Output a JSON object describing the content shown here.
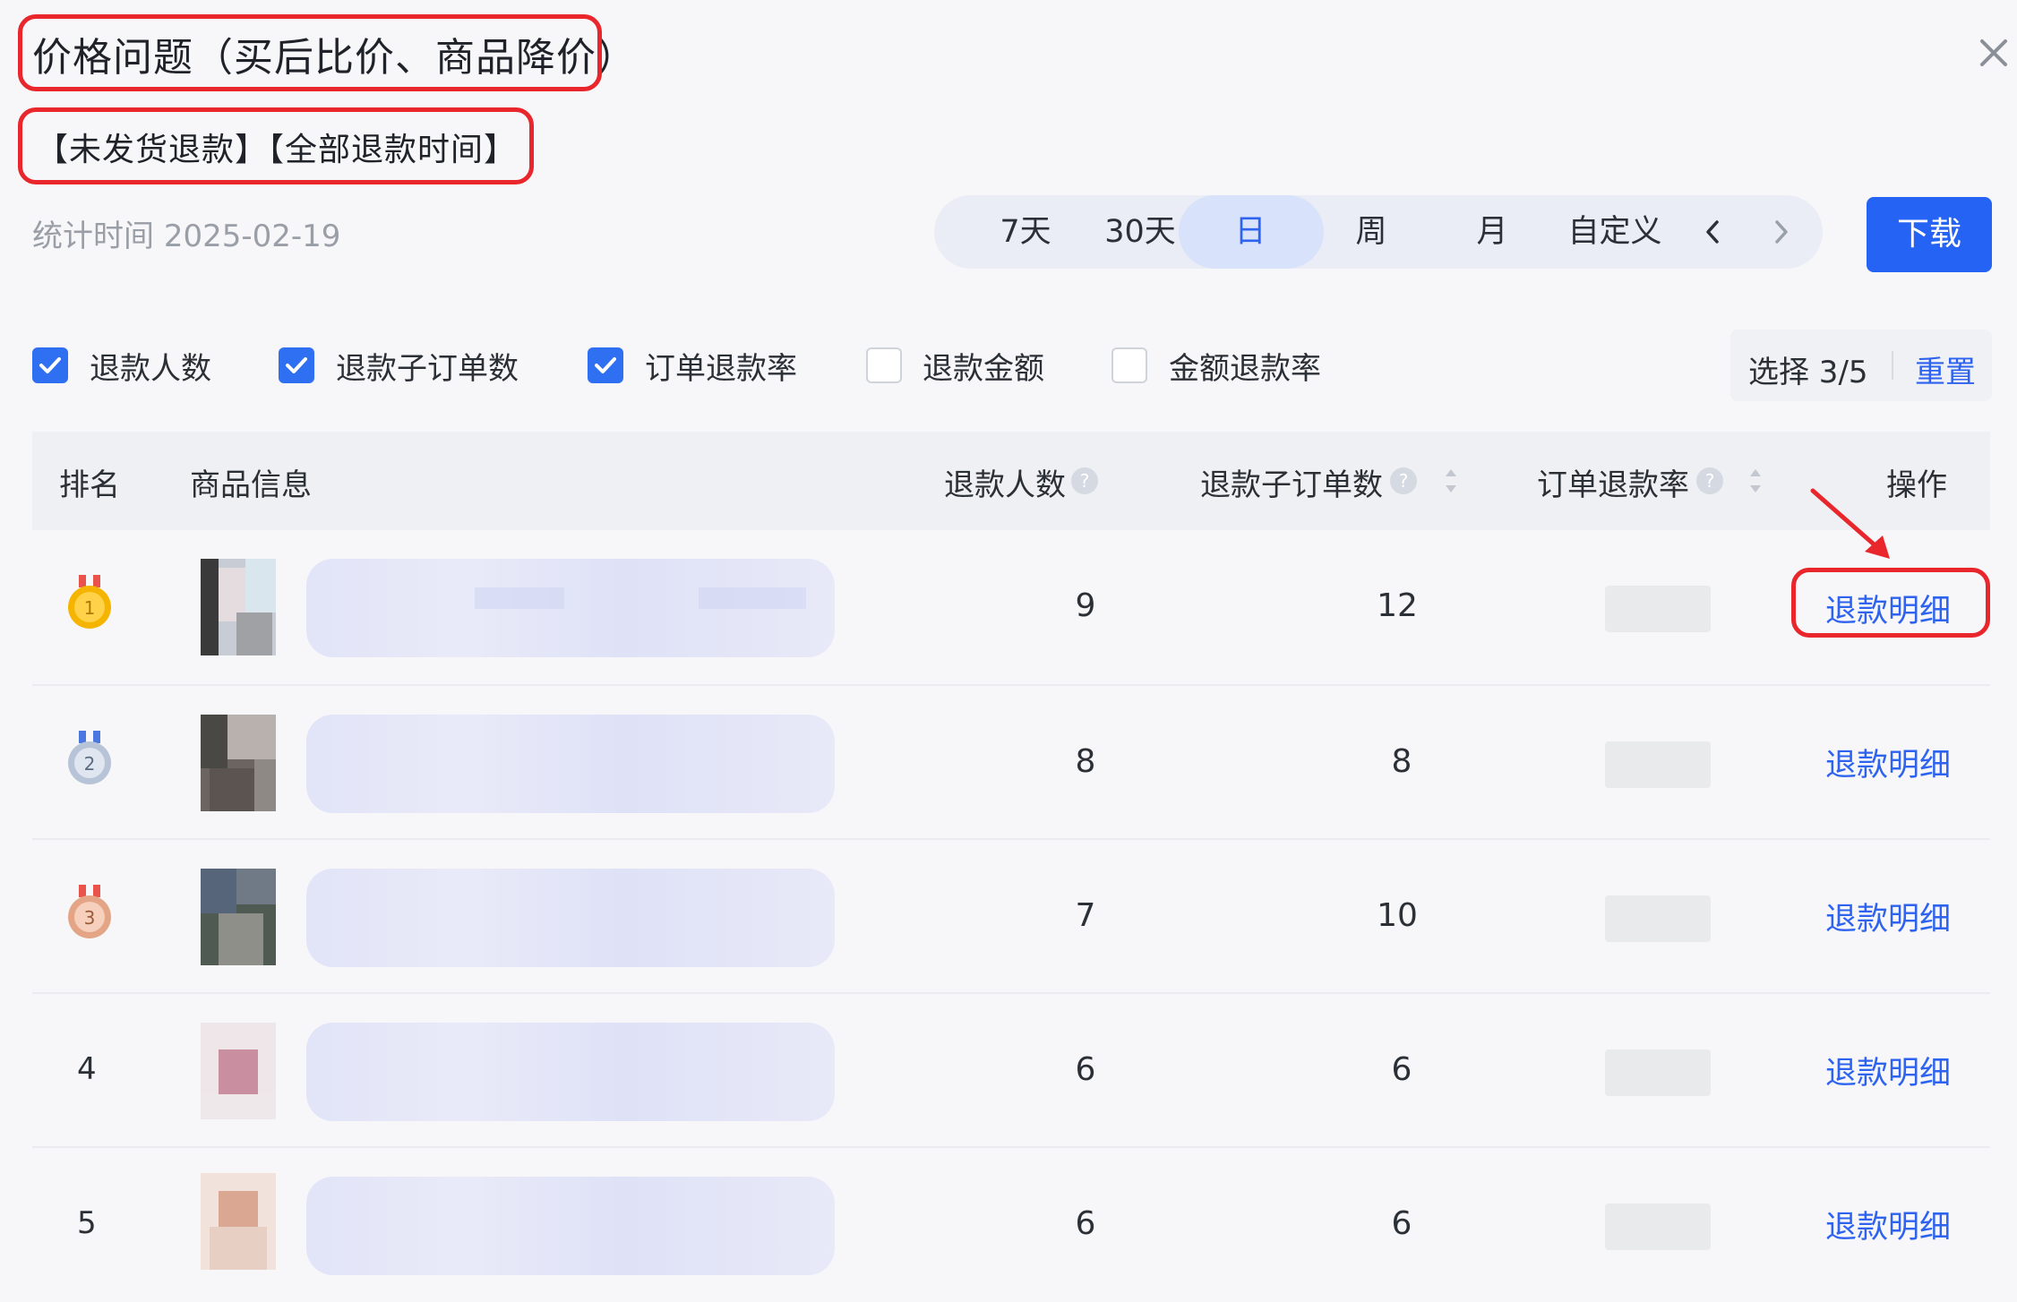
{
  "dialog": {
    "title": "价格问题（买后比价、商品降价）",
    "subtitle": "【未发货退款】【全部退款时间】",
    "stat_label": "统计时间",
    "stat_date": "2025-02-19"
  },
  "time_tabs": [
    {
      "label": "7天",
      "active": false
    },
    {
      "label": "30天",
      "active": false
    },
    {
      "label": "日",
      "active": true
    },
    {
      "label": "周",
      "active": false
    },
    {
      "label": "月",
      "active": false
    },
    {
      "label": "自定义",
      "active": false
    }
  ],
  "download_label": "下载",
  "metrics": [
    {
      "label": "退款人数",
      "checked": true
    },
    {
      "label": "退款子订单数",
      "checked": true
    },
    {
      "label": "订单退款率",
      "checked": true
    },
    {
      "label": "退款金额",
      "checked": false
    },
    {
      "label": "金额退款率",
      "checked": false
    }
  ],
  "selection": {
    "text": "选择 3/5",
    "reset": "重置"
  },
  "table": {
    "headers": {
      "rank": "排名",
      "product": "商品信息",
      "refund_people": "退款人数",
      "refund_suborders": "退款子订单数",
      "order_refund_rate": "订单退款率",
      "action": "操作"
    },
    "rows": [
      {
        "rank": "1",
        "medal": "gold-medal-icon",
        "refund_people": "9",
        "refund_suborders": "12",
        "action": "退款明细"
      },
      {
        "rank": "2",
        "medal": "silver-medal-icon",
        "refund_people": "8",
        "refund_suborders": "8",
        "action": "退款明细"
      },
      {
        "rank": "3",
        "medal": "bronze-medal-icon",
        "refund_people": "7",
        "refund_suborders": "10",
        "action": "退款明细"
      },
      {
        "rank": "4",
        "medal": null,
        "refund_people": "6",
        "refund_suborders": "6",
        "action": "退款明细"
      },
      {
        "rank": "5",
        "medal": null,
        "refund_people": "6",
        "refund_suborders": "6",
        "action": "退款明细"
      }
    ]
  },
  "colors": {
    "accent": "#2563f5",
    "annotation": "#e8262b",
    "link": "#2d63ef"
  }
}
